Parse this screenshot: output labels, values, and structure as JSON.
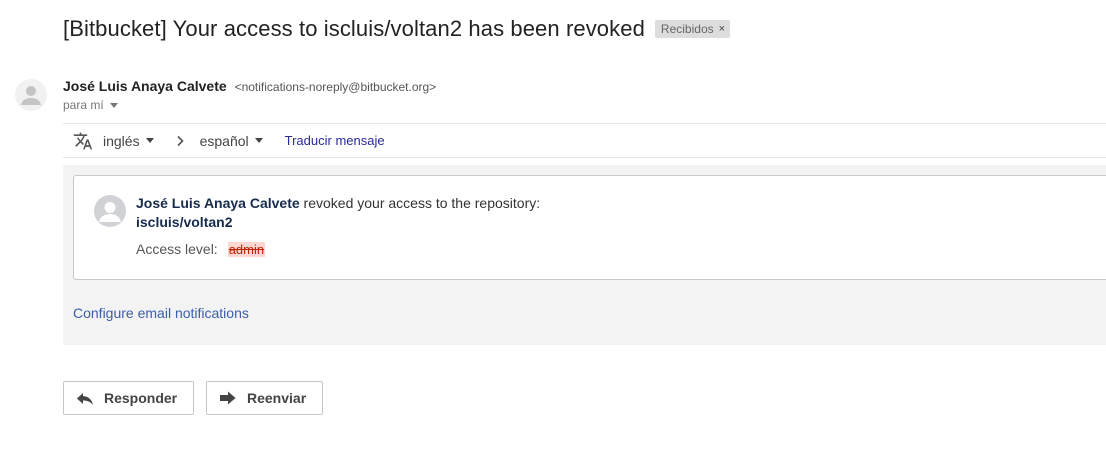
{
  "header": {
    "subject": "[Bitbucket] Your access to iscluis/voltan2 has been revoked",
    "label": "Recibidos",
    "label_remove": "×"
  },
  "sender": {
    "name": "José Luis Anaya Calvete",
    "email": "<notifications-noreply@bitbucket.org>",
    "to": "para mí"
  },
  "translate": {
    "icon": "translate-icon",
    "from_lang": "inglés",
    "to_lang": "español",
    "action": "Traducir mensaje"
  },
  "message": {
    "actor": "José Luis Anaya Calvete",
    "action_text": " revoked your access to the repository:",
    "repository": "iscluis/voltan2",
    "access_label": "Access level:",
    "access_value": "admin",
    "config_link": "Configure email notifications"
  },
  "actions": {
    "reply": "Responder",
    "forward": "Reenviar"
  },
  "colors": {
    "access_removed_bg": "#ffd6d2",
    "link": "#3b5eab",
    "label_bg": "#dddddd"
  }
}
